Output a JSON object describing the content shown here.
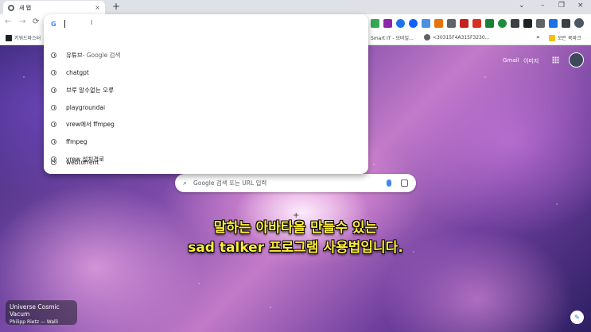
{
  "tab": {
    "title": "새 탭",
    "close": "×",
    "new_tab": "+"
  },
  "window": {
    "chevron": "⌄",
    "minimize": "–",
    "restore": "❐",
    "close": "×"
  },
  "toolbar": {
    "back": "←",
    "forward": "→",
    "reload": "⟳",
    "menu": "⋮"
  },
  "bookmarks": {
    "left": "키워드마스터",
    "smart": "Smart IT - 모바일...",
    "coord": "<30315F4A315F3230...",
    "more": "»",
    "all": "모든 북마크"
  },
  "omnibox": {
    "cursor": "I",
    "suggestions": [
      {
        "text": "유튜브",
        "suffix": " - Google 검색"
      },
      {
        "text": "chatgpt",
        "suffix": ""
      },
      {
        "text": "브루 알수없는 오류",
        "suffix": ""
      },
      {
        "text": "playgroundai",
        "suffix": ""
      },
      {
        "text": "vrew에서 ffmpeg",
        "suffix": ""
      },
      {
        "text": "ffmpeg",
        "suffix": ""
      },
      {
        "text": "vrew 설치경로",
        "suffix": ""
      },
      {
        "text": "webtorrent",
        "suffix": ""
      }
    ]
  },
  "ntp": {
    "gmail": "Gmail",
    "images": "이미지",
    "search_placeholder": "Google 검색 또는 URL 입력"
  },
  "subtitle": {
    "line1": "말하는 아바타을 만들수 있는",
    "line2": "sad talker 프로그램 사용법입니다."
  },
  "credit": {
    "title": "Universe Cosmic Vacum",
    "author": "Philipp Rietz — Walli"
  },
  "colors": {
    "accent": "#4285f4",
    "subtitle": "#ffef3a"
  }
}
